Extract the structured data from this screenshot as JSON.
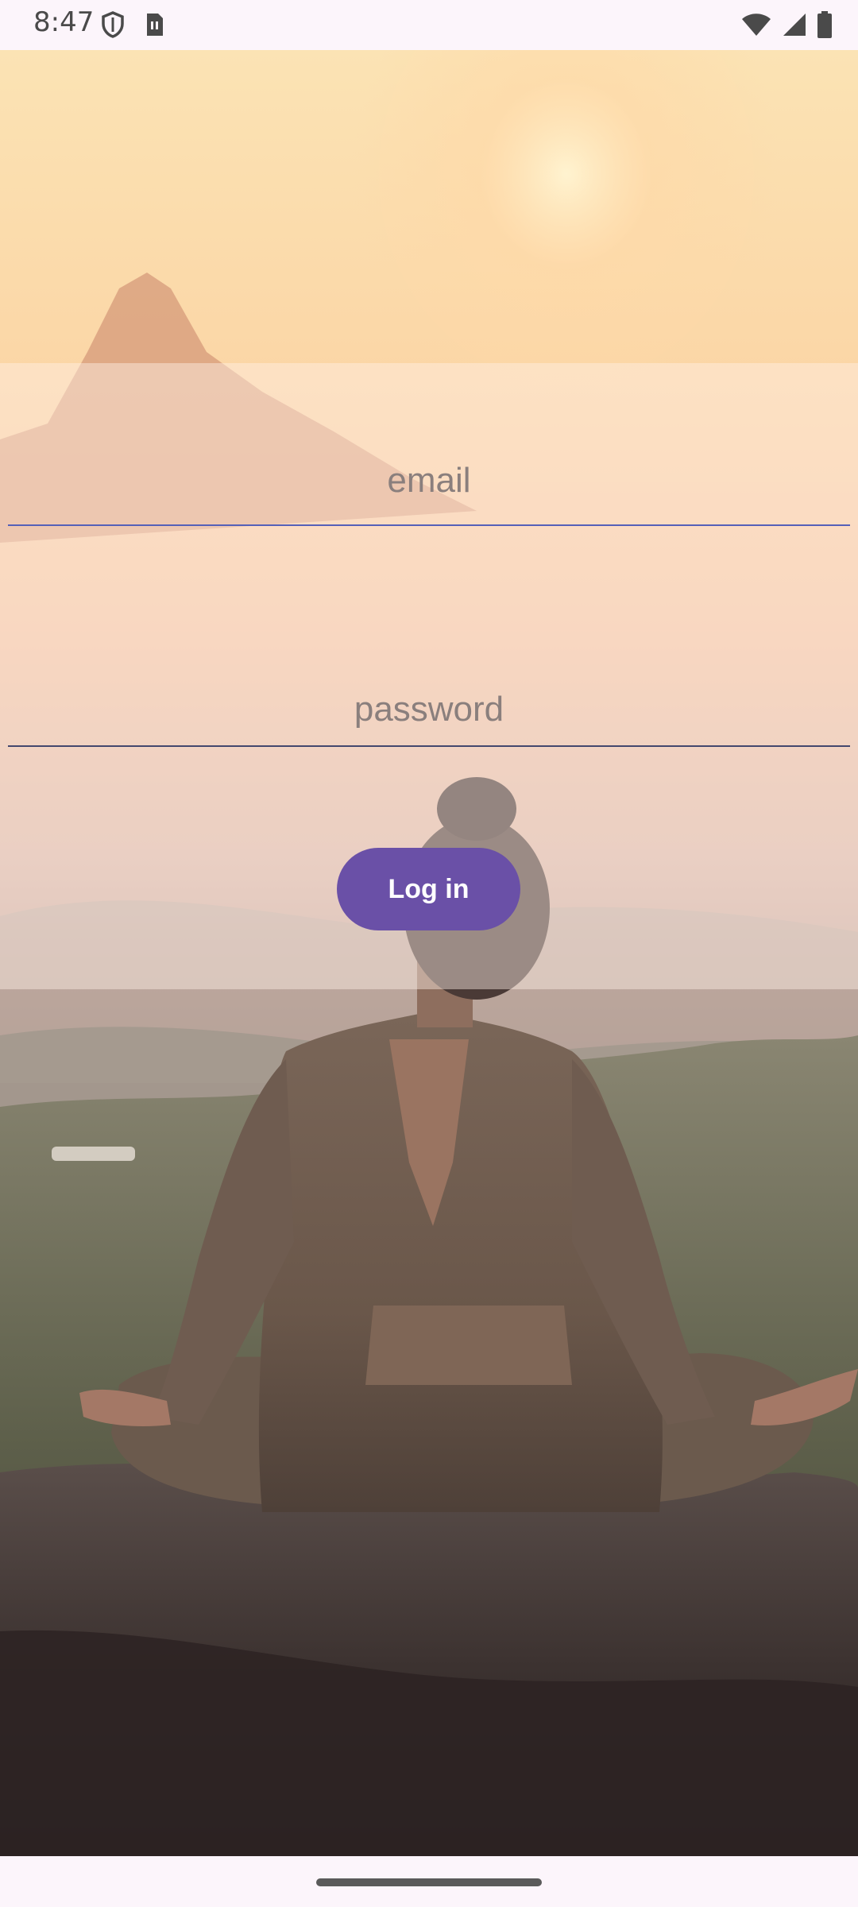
{
  "status_bar": {
    "time": "8:47",
    "icons": [
      "shield-icon",
      "sim-card-icon",
      "wifi-icon",
      "signal-icon",
      "battery-icon"
    ]
  },
  "login": {
    "email_placeholder": "email",
    "email_value": "",
    "password_placeholder": "password",
    "password_value": "",
    "button_label": "Log in"
  },
  "colors": {
    "accent": "#6a50a7",
    "email_underline": "#5560b8",
    "password_underline": "#43476e",
    "sky_top": "#fbe0b0",
    "sky_glow": "#fbd6b3"
  },
  "background_image": "meditation-on-mountain-at-sunset"
}
